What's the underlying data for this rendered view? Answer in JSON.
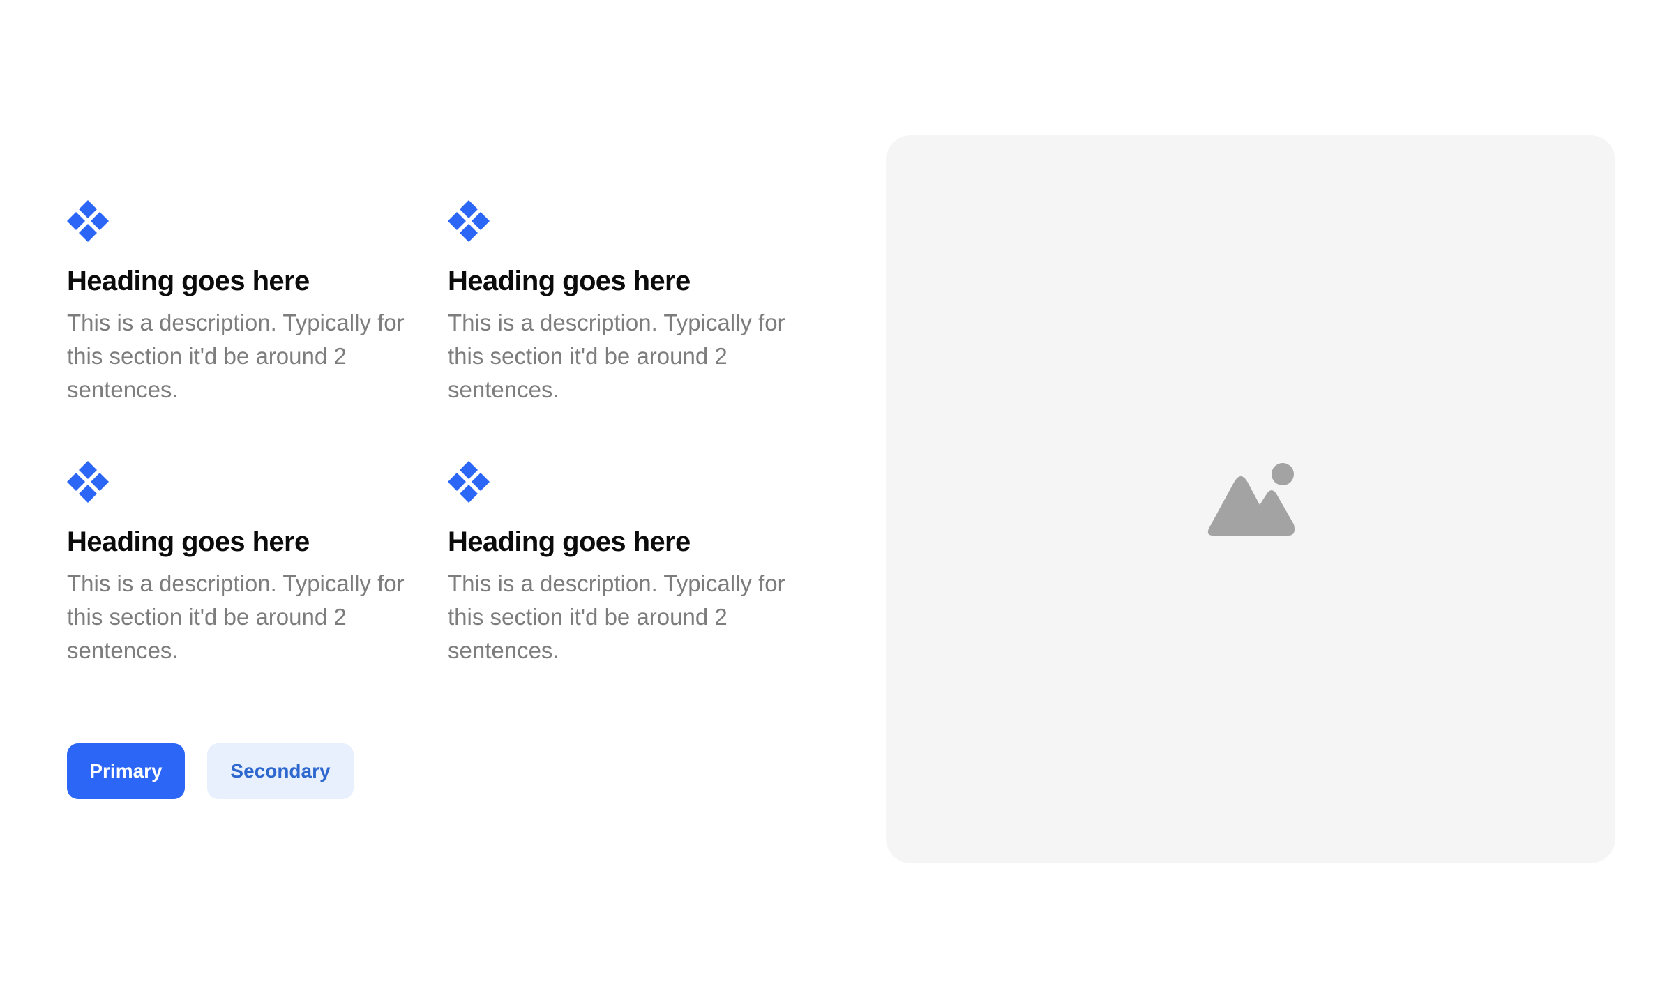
{
  "colors": {
    "accent": "#2b66f6",
    "heading": "#0b0b0b",
    "description": "#7d7d7d",
    "secondary_bg": "#e8f0fd",
    "secondary_text": "#2e68cf",
    "media_bg": "#f5f5f5",
    "placeholder_icon": "#a3a3a3"
  },
  "features": [
    {
      "icon": "diamond-cluster-icon",
      "heading": "Heading goes here",
      "description": "This is a description. Typically for this section it'd be around 2 sentences."
    },
    {
      "icon": "diamond-cluster-icon",
      "heading": "Heading goes here",
      "description": "This is a description. Typically for this section it'd be around 2 sentences."
    },
    {
      "icon": "diamond-cluster-icon",
      "heading": "Heading goes here",
      "description": "This is a description. Typically for this section it'd be around 2 sentences."
    },
    {
      "icon": "diamond-cluster-icon",
      "heading": "Heading goes here",
      "description": "This is a description. Typically for this section it'd be around 2 sentences."
    }
  ],
  "actions": {
    "primary_label": "Primary",
    "secondary_label": "Secondary"
  },
  "media": {
    "icon": "image-placeholder-icon"
  }
}
